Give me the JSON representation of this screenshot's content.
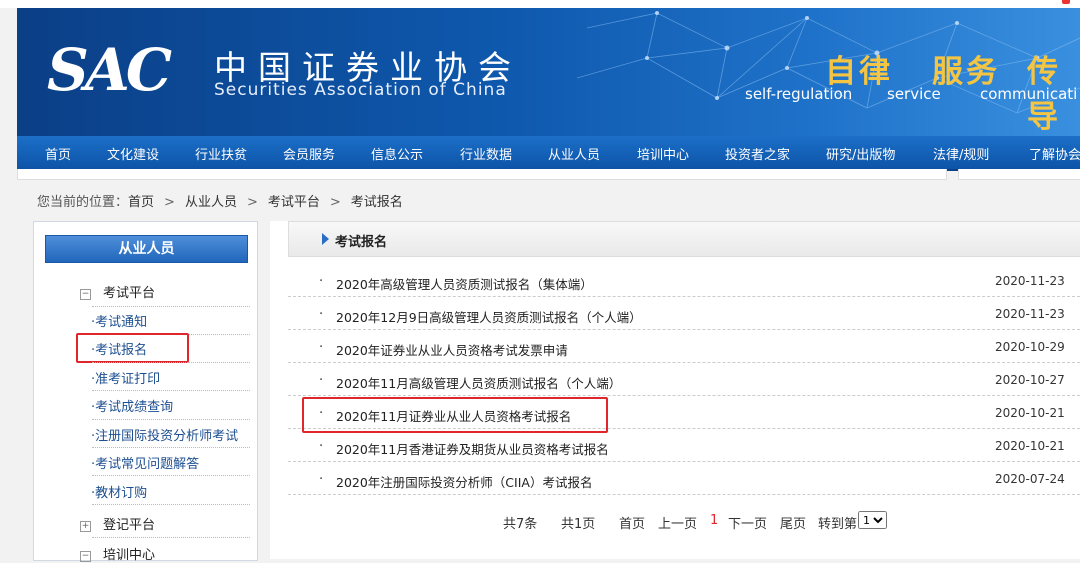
{
  "nav": {
    "items": [
      "首页",
      "文化建设",
      "行业扶贫",
      "会员服务",
      "信息公示",
      "行业数据",
      "从业人员",
      "培训中心",
      "投资者之家",
      "研究/出版物",
      "法律/规则",
      "了解协会"
    ]
  },
  "banner": {
    "logo": "SAC",
    "cn_name": "中国证券业协会",
    "en_name": "Securities Association of China",
    "slogan1": "自律",
    "slogan2": "服务",
    "slogan3": "传导",
    "slogan1_en": "self-regulation",
    "slogan2_en": "service",
    "slogan3_en": "communicati"
  },
  "breadcrumb": {
    "prefix": "您当前的位置：",
    "items": [
      "首页",
      "从业人员",
      "考试平台",
      "考试报名"
    ]
  },
  "sidebar": {
    "title": "从业人员",
    "cat1": "考试平台",
    "items": [
      "考试通知",
      "考试报名",
      "准考证打印",
      "考试成绩查询",
      "注册国际投资分析师考试",
      "考试常见问题解答",
      "教材订购"
    ],
    "cat2": "登记平台",
    "cat3": "培训中心",
    "expanded_icon": "⊟",
    "collapsed_icon": "⊞"
  },
  "main": {
    "title": "考试报名",
    "rows": [
      {
        "title": "2020年高级管理人员资质测试报名（集体端）",
        "date": "2020-11-23"
      },
      {
        "title": "2020年12月9日高级管理人员资质测试报名（个人端）",
        "date": "2020-11-23"
      },
      {
        "title": "2020年证券业从业人员资格考试发票申请",
        "date": "2020-10-29"
      },
      {
        "title": "2020年11月高级管理人员资质测试报名（个人端）",
        "date": "2020-10-27"
      },
      {
        "title": "2020年11月证券业从业人员资格考试报名",
        "date": "2020-10-21"
      },
      {
        "title": "2020年11月香港证券及期货从业员资格考试报名",
        "date": "2020-10-21"
      },
      {
        "title": "2020年注册国际投资分析师（CIIA）考试报名",
        "date": "2020-07-24"
      }
    ]
  },
  "pager": {
    "total": "共7条",
    "pages": "共1页",
    "first": "首页",
    "prev": "上一页",
    "current": "1",
    "next": "下一页",
    "last": "尾页",
    "goto": "转到第",
    "select_value": "1"
  },
  "colors": {
    "nav_blue": "#0d54a8",
    "link_blue": "#1d4f91",
    "highlight_red": "#e0262b",
    "slogan_gold": "#f4c542"
  }
}
